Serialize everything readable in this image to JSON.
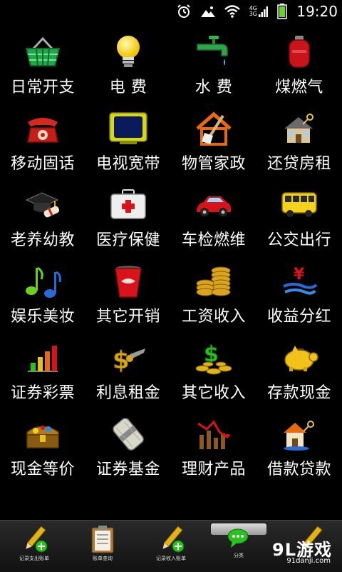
{
  "status_bar": {
    "time": "19:20",
    "network_label_top": "4G",
    "network_label_bottom": "3G",
    "icons": [
      "alarm-icon",
      "photo-icon",
      "wifi-icon",
      "signal-icon",
      "battery-icon"
    ]
  },
  "grid": {
    "rows": [
      [
        {
          "label": "日常开支",
          "icon": "basket-icon"
        },
        {
          "label": "电 费",
          "icon": "lightbulb-icon"
        },
        {
          "label": "水 费",
          "icon": "faucet-icon"
        },
        {
          "label": "煤燃气",
          "icon": "gas-cylinder-icon"
        }
      ],
      [
        {
          "label": "移动固话",
          "icon": "telephone-icon"
        },
        {
          "label": "电视宽带",
          "icon": "tv-icon"
        },
        {
          "label": "物管家政",
          "icon": "house-broom-icon"
        },
        {
          "label": "还贷房租",
          "icon": "house-key-icon"
        }
      ],
      [
        {
          "label": "老养幼教",
          "icon": "graduation-cap-icon"
        },
        {
          "label": "医疗保健",
          "icon": "first-aid-kit-icon"
        },
        {
          "label": "车检燃维",
          "icon": "car-icon"
        },
        {
          "label": "公交出行",
          "icon": "bus-icon"
        }
      ],
      [
        {
          "label": "娱乐美妆",
          "icon": "music-note-icon"
        },
        {
          "label": "其它开销",
          "icon": "cola-cup-icon"
        },
        {
          "label": "工资收入",
          "icon": "coin-stack-icon"
        },
        {
          "label": "收益分红",
          "icon": "yen-icon"
        }
      ],
      [
        {
          "label": "证券彩票",
          "icon": "bar-chart-icon"
        },
        {
          "label": "利息租金",
          "icon": "dollar-icon"
        },
        {
          "label": "其它收入",
          "icon": "money-pile-icon"
        },
        {
          "label": "存款现金",
          "icon": "piggy-bank-icon"
        }
      ],
      [
        {
          "label": "现金等价",
          "icon": "treasure-chest-icon"
        },
        {
          "label": "证券基金",
          "icon": "money-roll-icon"
        },
        {
          "label": "理财产品",
          "icon": "stock-chart-icon"
        },
        {
          "label": "借款贷款",
          "icon": "house-loan-icon"
        }
      ]
    ]
  },
  "bottom_tabs": [
    {
      "label": "记录支出账单",
      "icon": "pencil-add-icon"
    },
    {
      "label": "账单查询",
      "icon": "clipboard-icon"
    },
    {
      "label": "记录收入账单",
      "icon": "pencil-add-icon"
    },
    {
      "label": "分类",
      "icon": "chat-bubble-icon"
    },
    {
      "label": "",
      "icon": "pencil-icon"
    }
  ],
  "watermark": {
    "main": "9L游戏",
    "sub": "91danji.com"
  },
  "colors": {
    "background": "#000000",
    "text": "#ffffff",
    "bar": "#222222"
  }
}
